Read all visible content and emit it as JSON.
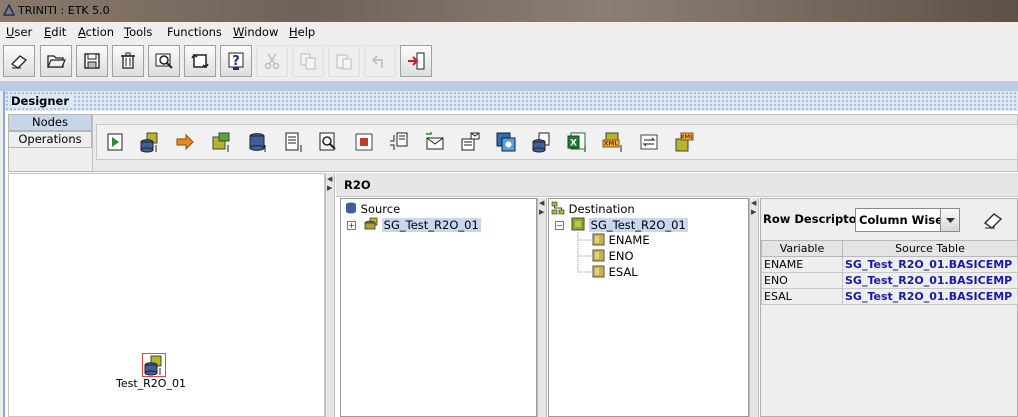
{
  "window": {
    "title": "TRINITI : ETK 5.0"
  },
  "menu": [
    {
      "pre": "",
      "u": "U",
      "post": "ser"
    },
    {
      "pre": "",
      "u": "E",
      "post": "dit"
    },
    {
      "pre": "",
      "u": "A",
      "post": "ction"
    },
    {
      "pre": "",
      "u": "T",
      "post": "ools"
    },
    {
      "pre": "",
      "u": "",
      "post": "Functions"
    },
    {
      "pre": "",
      "u": "W",
      "post": "indow"
    },
    {
      "pre": "",
      "u": "H",
      "post": "elp"
    }
  ],
  "toolbar": {
    "buttons": [
      {
        "icon": "eraser-icon",
        "enabled": true
      },
      {
        "icon": "open-folder-icon",
        "enabled": true
      },
      {
        "icon": "save-icon",
        "enabled": true
      },
      {
        "icon": "trash-icon",
        "enabled": true
      },
      {
        "icon": "find-icon",
        "enabled": true
      },
      {
        "icon": "refresh-icon",
        "enabled": true
      },
      {
        "icon": "help-icon",
        "enabled": true
      },
      {
        "icon": "cut-icon",
        "enabled": false
      },
      {
        "icon": "copy-icon",
        "enabled": false
      },
      {
        "icon": "paste-icon",
        "enabled": false
      },
      {
        "icon": "undo-icon",
        "enabled": false
      },
      {
        "icon": "exit-icon",
        "enabled": true
      }
    ]
  },
  "designer": {
    "title": "Designer",
    "tabs": [
      "Nodes",
      "Operations"
    ],
    "selected_tab": "Nodes"
  },
  "palette_icons": [
    "run-icon",
    "db-source-icon",
    "arrow-right-icon",
    "cube-target-icon",
    "db-target-icon",
    "document-icon",
    "search-doc-icon",
    "stop-icon",
    "split-icon",
    "mail-in-icon",
    "mail-out-icon",
    "copy-window-icon",
    "db-export-icon",
    "excel-icon",
    "xml-icon",
    "transform-icon",
    "xml-cube-icon"
  ],
  "canvas": {
    "node_label": "Test_R2O_01"
  },
  "r2o": {
    "title": "R2O",
    "source": {
      "header": "Source",
      "item": "SG_Test_R2O_01"
    },
    "destination": {
      "header": "Destination",
      "item": "SG_Test_R2O_01",
      "fields": [
        "ENAME",
        "ENO",
        "ESAL"
      ]
    },
    "row_descriptor": {
      "label": "Row Descriptor",
      "value": "Column Wise"
    },
    "table": {
      "columns": [
        "Variable",
        "Source Table"
      ],
      "rows": [
        {
          "variable": "ENAME",
          "source": "SG_Test_R2O_01.BASICEMP"
        },
        {
          "variable": "ENO",
          "source": "SG_Test_R2O_01.BASICEMP"
        },
        {
          "variable": "ESAL",
          "source": "SG_Test_R2O_01.BASICEMP"
        }
      ]
    }
  }
}
